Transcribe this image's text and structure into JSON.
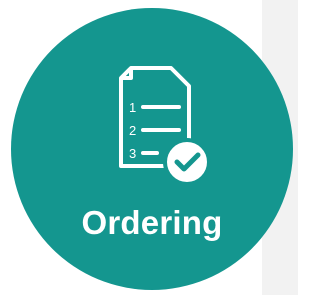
{
  "tile": {
    "label": "Ordering",
    "icon": "ordered-list-checkmark-icon",
    "background_color": "#14968f",
    "foreground_color": "#ffffff"
  },
  "icon_list": {
    "numbers": [
      "1",
      "2",
      "3"
    ]
  }
}
